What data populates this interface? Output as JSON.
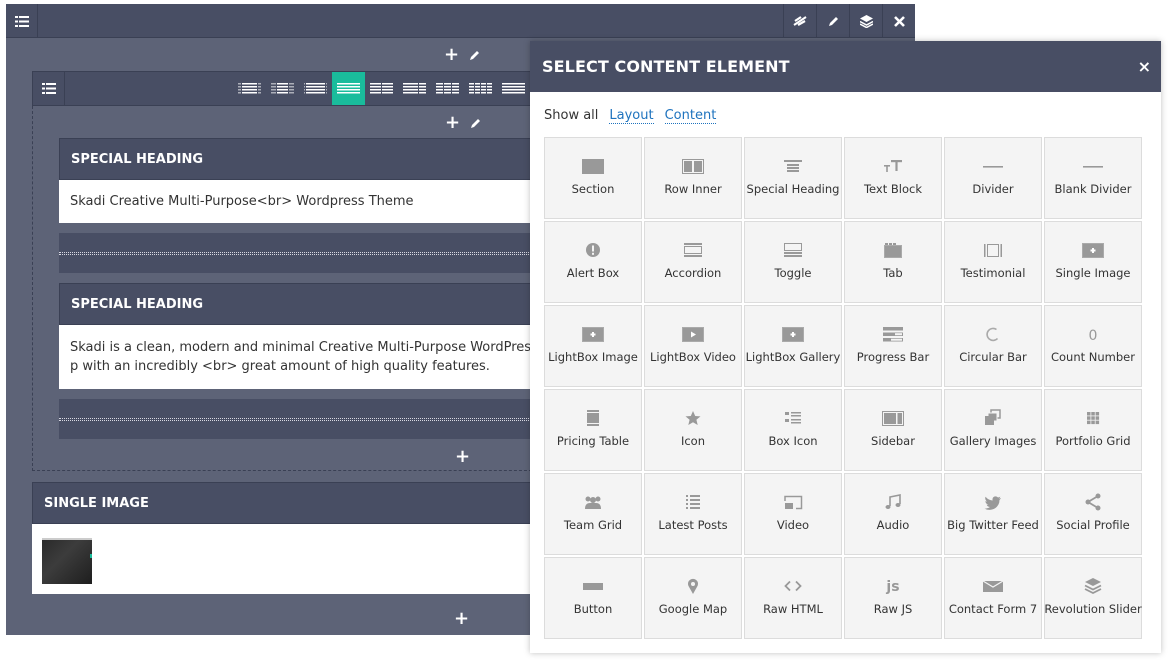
{
  "builder": {
    "top_actions": [
      {
        "name": "hide-icon",
        "glyph": "⊘"
      },
      {
        "name": "pencil-icon",
        "glyph": "✎"
      },
      {
        "name": "layers-icon",
        "glyph": "≋"
      },
      {
        "name": "close-icon",
        "glyph": "✕"
      }
    ],
    "row_tools": {
      "add": "+",
      "edit": "✎"
    },
    "layout_options": [
      "1/6+4/6+1/6",
      "1/4+1/2+1/4",
      "1/12+10/12+1/12",
      "1/1",
      "1/2+1/2",
      "2/3+1/3",
      "1/3+1/3+1/3",
      "1/4+1/4+1/4+1/4",
      "1/6x6"
    ],
    "active_layout_index": 3,
    "elements": [
      {
        "type": "heading",
        "title": "SPECIAL HEADING",
        "text": "Skadi Creative Multi-Purpose<br> Wordpress Theme"
      },
      {
        "type": "divider"
      },
      {
        "type": "heading",
        "title": "SPECIAL HEADING",
        "text_line1": "Skadi is a clean, modern and minimal Creative Multi-Purpose WordPress the",
        "text_line2": "p with an incredibly <br> great amount of high quality features."
      },
      {
        "type": "divider"
      }
    ],
    "single_image": {
      "title": "SINGLE IMAGE"
    }
  },
  "modal": {
    "title": "SELECT CONTENT ELEMENT",
    "close": "×",
    "filters": {
      "show_all": "Show all",
      "layout": "Layout",
      "content": "Content"
    },
    "items": [
      {
        "label": "Section",
        "icon": "section-icon"
      },
      {
        "label": "Row Inner",
        "icon": "row-inner-icon"
      },
      {
        "label": "Special Heading",
        "icon": "heading-icon"
      },
      {
        "label": "Text Block",
        "icon": "text-size-icon"
      },
      {
        "label": "Divider",
        "icon": "divider-icon"
      },
      {
        "label": "Blank Divider",
        "icon": "blank-divider-icon"
      },
      {
        "label": "Alert Box",
        "icon": "alert-icon"
      },
      {
        "label": "Accordion",
        "icon": "accordion-icon"
      },
      {
        "label": "Toggle",
        "icon": "toggle-icon"
      },
      {
        "label": "Tab",
        "icon": "tab-icon"
      },
      {
        "label": "Testimonial",
        "icon": "testimonial-icon"
      },
      {
        "label": "Single Image",
        "icon": "image-plus-icon"
      },
      {
        "label": "LightBox Image",
        "icon": "image-plus-icon"
      },
      {
        "label": "LightBox Video",
        "icon": "video-play-icon"
      },
      {
        "label": "LightBox Gallery",
        "icon": "image-plus-icon"
      },
      {
        "label": "Progress Bar",
        "icon": "progress-bar-icon"
      },
      {
        "label": "Circular Bar",
        "icon": "circular-bar-icon"
      },
      {
        "label": "Count Number",
        "icon": "count-number-icon"
      },
      {
        "label": "Pricing Table",
        "icon": "pricing-table-icon"
      },
      {
        "label": "Icon",
        "icon": "star-icon"
      },
      {
        "label": "Box Icon",
        "icon": "list-icon"
      },
      {
        "label": "Sidebar",
        "icon": "sidebar-icon"
      },
      {
        "label": "Gallery Images",
        "icon": "gallery-icon"
      },
      {
        "label": "Portfolio Grid",
        "icon": "grid-icon"
      },
      {
        "label": "Team Grid",
        "icon": "team-icon"
      },
      {
        "label": "Latest Posts",
        "icon": "posts-list-icon"
      },
      {
        "label": "Video",
        "icon": "cast-icon"
      },
      {
        "label": "Audio",
        "icon": "music-icon"
      },
      {
        "label": "Big Twitter Feed",
        "icon": "twitter-icon"
      },
      {
        "label": "Social Profile",
        "icon": "share-icon"
      },
      {
        "label": "Button",
        "icon": "button-icon"
      },
      {
        "label": "Google Map",
        "icon": "map-pin-icon"
      },
      {
        "label": "Raw HTML",
        "icon": "code-icon"
      },
      {
        "label": "Raw JS",
        "icon": "js-icon"
      },
      {
        "label": "Contact Form 7",
        "icon": "envelope-icon"
      },
      {
        "label": "Revolution Slider",
        "icon": "layers-icon"
      }
    ]
  },
  "colors": {
    "accent": "#1abc9c",
    "panel_dark": "#484e64",
    "panel_mid": "#5d6377",
    "link": "#1e73be"
  }
}
